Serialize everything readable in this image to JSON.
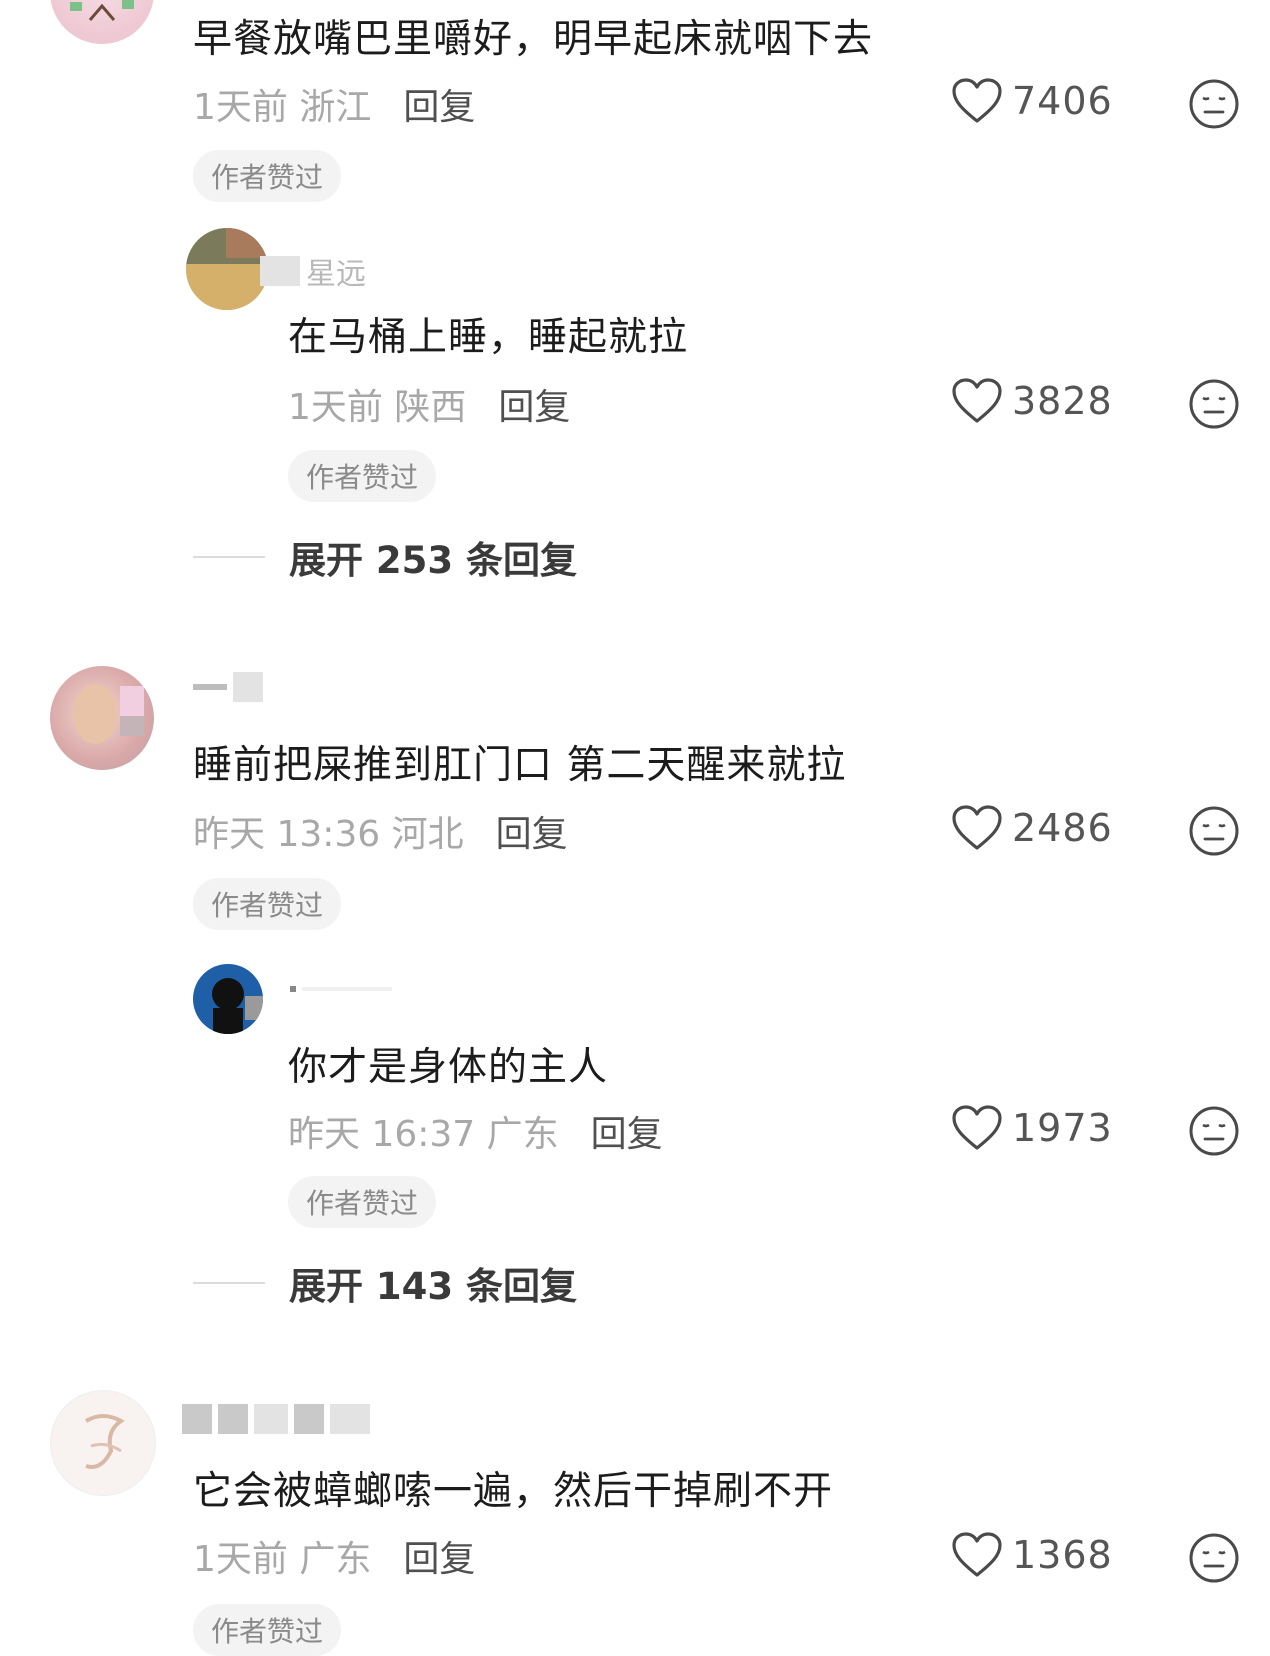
{
  "comments": [
    {
      "text": "早餐放嘴巴里嚼好，明早起床就咽下去",
      "time_location": "1天前 浙江",
      "reply_label": "回复",
      "likes": "7406",
      "badge": "作者赞过"
    },
    {
      "username": "星远",
      "text": "在马桶上睡，睡起就拉",
      "time_location": "1天前 陕西",
      "reply_label": "回复",
      "likes": "3828",
      "badge": "作者赞过"
    },
    {
      "expand_label": "展开 253 条回复"
    },
    {
      "text": "睡前把屎推到肛门口 第二天醒来就拉",
      "time_location": "昨天 13:36 河北",
      "reply_label": "回复",
      "likes": "2486",
      "badge": "作者赞过"
    },
    {
      "text": "你才是身体的主人",
      "time_location": "昨天 16:37 广东",
      "reply_label": "回复",
      "likes": "1973",
      "badge": "作者赞过"
    },
    {
      "expand_label": "展开 143 条回复"
    },
    {
      "text": "它会被蟑螂嗦一遍，然后干掉刷不开",
      "time_location": "1天前 广东",
      "reply_label": "回复",
      "likes": "1368",
      "badge": "作者赞过"
    }
  ],
  "icons": {
    "like": "heart-outline-icon",
    "dislike": "neutral-face-icon"
  },
  "colors": {
    "text": "#1c1c1c",
    "meta": "#a8a8a8",
    "badge_bg": "#f3f3f3"
  }
}
